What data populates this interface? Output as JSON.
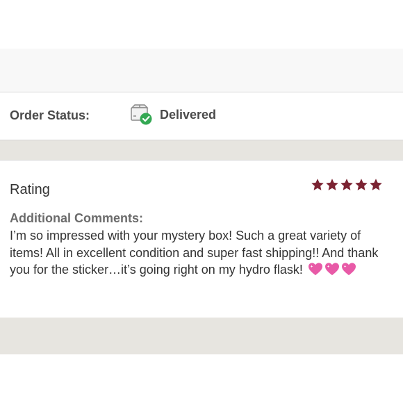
{
  "order_status": {
    "label": "Order Status:",
    "value": "Delivered",
    "icon": "delivered-box-icon"
  },
  "review": {
    "rating_label": "Rating",
    "rating_value": 5,
    "rating_max": 5,
    "comments_label": "Additional Comments:",
    "comments_text": "I’m so impressed with your mystery box! Such a great variety of items! All in excellent condition and super fast shipping!! And thank you for the sticker…it’s going right on my hydro flask!",
    "emoji_count": 3,
    "emoji_icon": "sparkling-heart-icon"
  },
  "colors": {
    "star": "#7b2332",
    "check": "#34a853",
    "heart": "#e85aa7",
    "band": "#e7e5e0"
  }
}
